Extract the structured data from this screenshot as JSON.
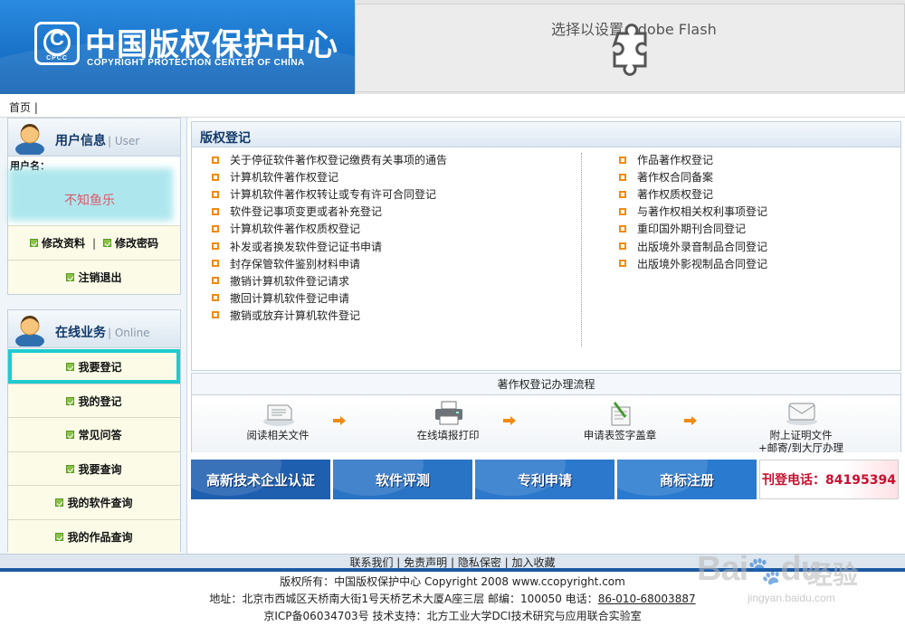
{
  "header": {
    "logo_cn": "中国版权保护中心",
    "logo_en": "COPYRIGHT PROTECTION CENTER OF CHINA",
    "logo_mark_letter": "C",
    "logo_mark_abbr": "CPCC",
    "flash_text": "选择以设置 Adobe Flash"
  },
  "breadcrumb": "首页 |",
  "sidebar": {
    "user_box": {
      "title": "用户信息",
      "subtitle": "| User",
      "username_label": "用户名：",
      "username_value": "不知鱼乐",
      "links": [
        "修改资料",
        "修改密码"
      ],
      "links_separator": "|",
      "logout": "注销退出"
    },
    "online_box": {
      "title": "在线业务",
      "subtitle": "| Online",
      "items": [
        "我要登记",
        "我的登记",
        "常见问答",
        "我要查询",
        "我的软件查询",
        "我的作品查询"
      ]
    }
  },
  "main": {
    "panel_title": "版权登记",
    "left_links": [
      "关于停征软件著作权登记缴费有关事项的通告",
      "计算机软件著作权登记",
      "计算机软件著作权转让或专有许可合同登记",
      "软件登记事项变更或者补充登记",
      "计算机软件著作权质权登记",
      "补发或者换发软件登记证书申请",
      "封存保管软件鉴别材料申请",
      "撤销计算机软件登记请求",
      "撤回计算机软件登记申请",
      "撤销或放弃计算机软件登记"
    ],
    "right_links": [
      "作品著作权登记",
      "著作权合同备案",
      "著作权质权登记",
      "与著作权相关权利事项登记",
      "重印国外期刊合同登记",
      "出版境外录音制品合同登记",
      "出版境外影视制品合同登记"
    ],
    "process": {
      "title": "著作权登记办理流程",
      "steps": [
        {
          "label": "阅读相关文件",
          "icon": "document-stack-icon"
        },
        {
          "label": "在线填报打印",
          "icon": "printer-icon"
        },
        {
          "label": "申请表签字盖章",
          "icon": "pen-sign-icon"
        },
        {
          "label": "附上证明文件",
          "label2": "+邮寄/到大厅办理",
          "icon": "envelope-icon"
        }
      ]
    },
    "banners": [
      {
        "label": "高新技术企业认证",
        "color": "#1f5fb0"
      },
      {
        "label": "软件评测",
        "color": "#2a74c6"
      },
      {
        "label": "专利申请",
        "color": "#2c78cc"
      },
      {
        "label": "商标注册",
        "color": "#2a7ad0"
      },
      {
        "label": "刊登电话：84195394",
        "color": "#c8102e"
      }
    ]
  },
  "footer": {
    "links": [
      "联系我们",
      "免责声明",
      "隐私保密",
      "加入收藏"
    ],
    "line1": "版权所有：中国版权保护中心 Copyright 2008 www.ccopyright.com",
    "line2_prefix": "地址：北京市西城区天桥南大街1号天桥艺术大厦A座三层 邮编：100050 电话：",
    "line2_phone": "86-010-68003887",
    "line3": "京ICP备06034703号 技术支持：北方工业大学DCI技术研究与应用联合实验室"
  },
  "watermark": {
    "brand": "Bai",
    "brand2": "du",
    "cn": "经验",
    "url": "jingyan.baidu.com"
  }
}
